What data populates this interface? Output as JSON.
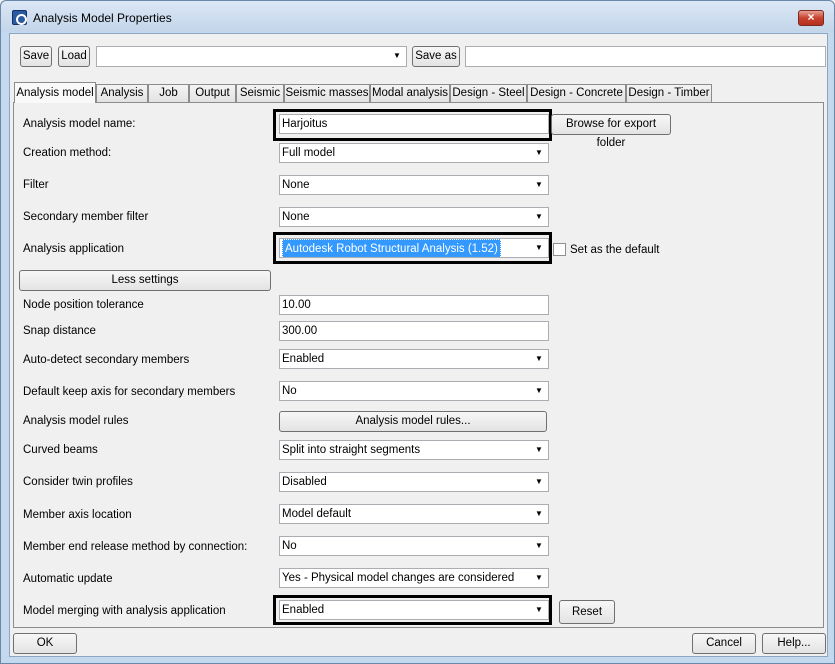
{
  "window": {
    "title": "Analysis Model Properties",
    "close_label": "×"
  },
  "toolbar": {
    "save_label": "Save",
    "load_label": "Load",
    "settings_value": "",
    "save_as_label": "Save as",
    "save_as_value": ""
  },
  "tabs": [
    {
      "label": "Analysis model",
      "active": true
    },
    {
      "label": "Analysis"
    },
    {
      "label": "Job"
    },
    {
      "label": "Output"
    },
    {
      "label": "Seismic"
    },
    {
      "label": "Seismic masses"
    },
    {
      "label": "Modal analysis"
    },
    {
      "label": "Design - Steel"
    },
    {
      "label": "Design - Concrete"
    },
    {
      "label": "Design - Timber"
    }
  ],
  "form": {
    "model_name": {
      "label": "Analysis model name:",
      "value": "Harjoitus"
    },
    "browse_label": "Browse for export folder",
    "creation_method": {
      "label": "Creation method:",
      "value": "Full model"
    },
    "filter": {
      "label": "Filter",
      "value": "None"
    },
    "secondary_filter": {
      "label": "Secondary member filter",
      "value": "None"
    },
    "analysis_app": {
      "label": "Analysis application",
      "value": "Autodesk Robot Structural Analysis (1.52)"
    },
    "set_default_label": "Set as the default",
    "less_settings_label": "Less settings",
    "node_tolerance": {
      "label": "Node position tolerance",
      "value": "10.00"
    },
    "snap_distance": {
      "label": "Snap distance",
      "value": "300.00"
    },
    "auto_detect": {
      "label": "Auto-detect secondary members",
      "value": "Enabled"
    },
    "keep_axis": {
      "label": "Default keep axis for secondary members",
      "value": "No"
    },
    "model_rules": {
      "label": "Analysis model rules",
      "button": "Analysis model rules..."
    },
    "curved_beams": {
      "label": "Curved beams",
      "value": "Split into straight segments"
    },
    "twin_profiles": {
      "label": "Consider twin profiles",
      "value": "Disabled"
    },
    "axis_location": {
      "label": "Member axis location",
      "value": "Model default"
    },
    "end_release": {
      "label": "Member end release method by connection:",
      "value": "No"
    },
    "auto_update": {
      "label": "Automatic update",
      "value": "Yes - Physical model changes are considered"
    },
    "model_merging": {
      "label": "Model merging with analysis application",
      "value": "Enabled"
    },
    "reset_label": "Reset"
  },
  "footer": {
    "ok_label": "OK",
    "cancel_label": "Cancel",
    "help_label": "Help..."
  }
}
